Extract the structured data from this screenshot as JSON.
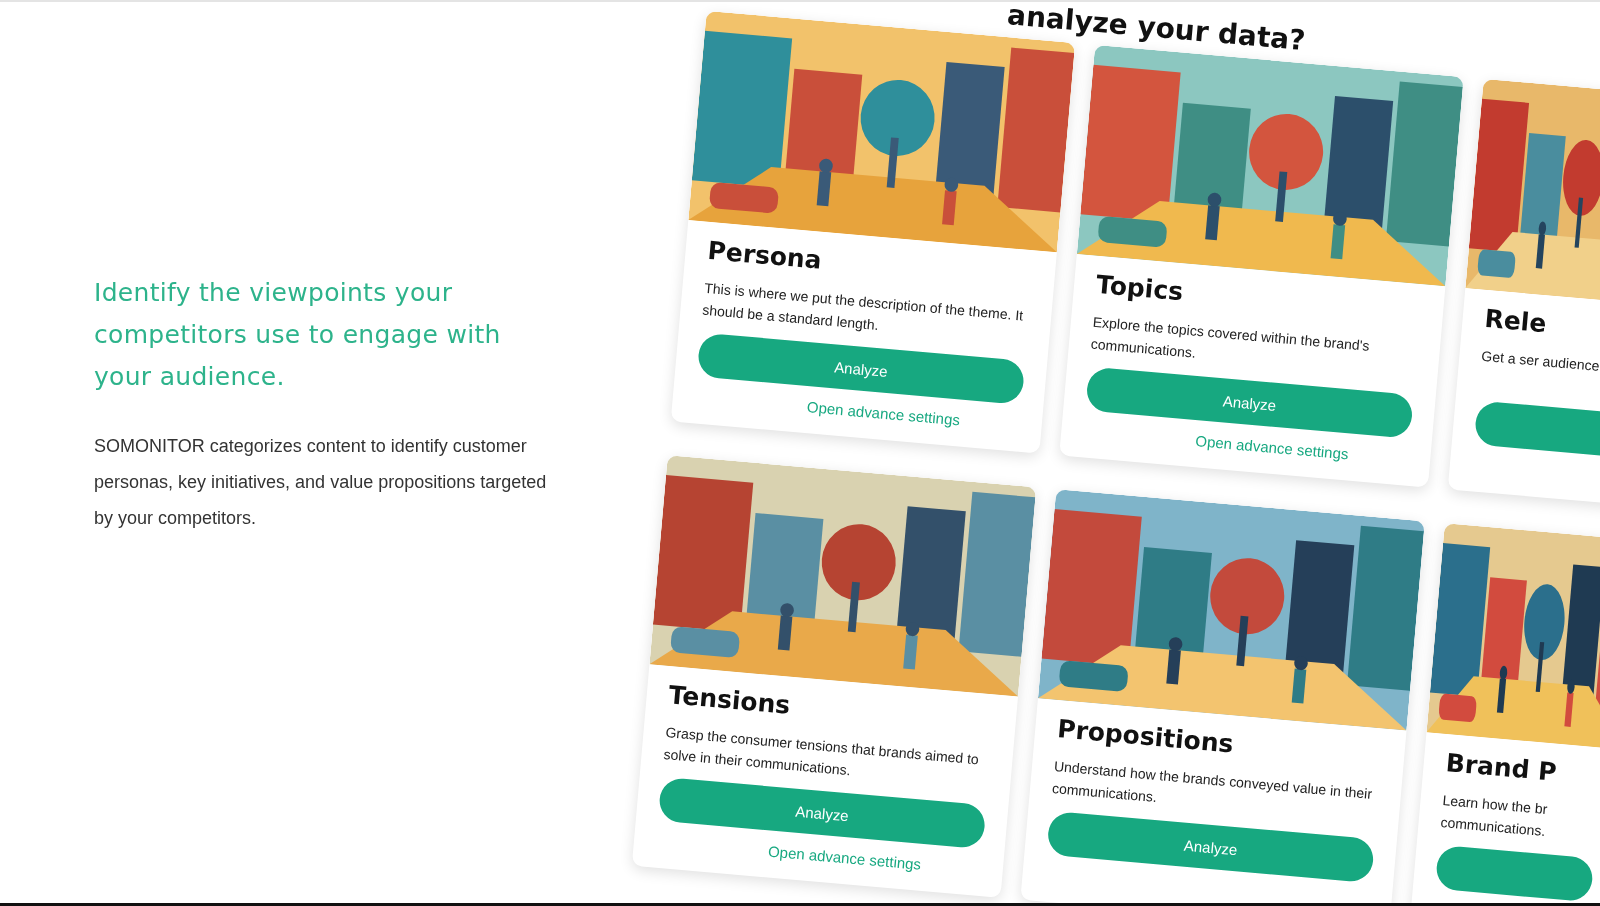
{
  "intro": {
    "heading": "Identify the viewpoints your competitors use to engage with your audience.",
    "body": "SOMONITOR categorizes content to identify customer personas, key initiatives, and value propositions targeted by your competitors."
  },
  "preview": {
    "heading": "analyze your data?",
    "cards": [
      {
        "title": "Persona",
        "description": "This is where we put the description of the theme. It should be a standard length.",
        "button": "Analyze",
        "link": "Open advance settings"
      },
      {
        "title": "Topics",
        "description": "Explore the topics covered within the brand's communications.",
        "button": "Analyze",
        "link": "Open advance settings"
      },
      {
        "title": "Rele",
        "description": "Get a ser audience"
      },
      {
        "title": "Tensions",
        "description": "Grasp the consumer tensions that brands aimed to solve in their communications.",
        "button": "Analyze",
        "link": "Open advance settings"
      },
      {
        "title": "Propositions",
        "description": "Understand how the brands conveyed value in their communications.",
        "button": "Analyze"
      },
      {
        "title": "Brand P",
        "description": "Learn how the br communications."
      }
    ]
  }
}
